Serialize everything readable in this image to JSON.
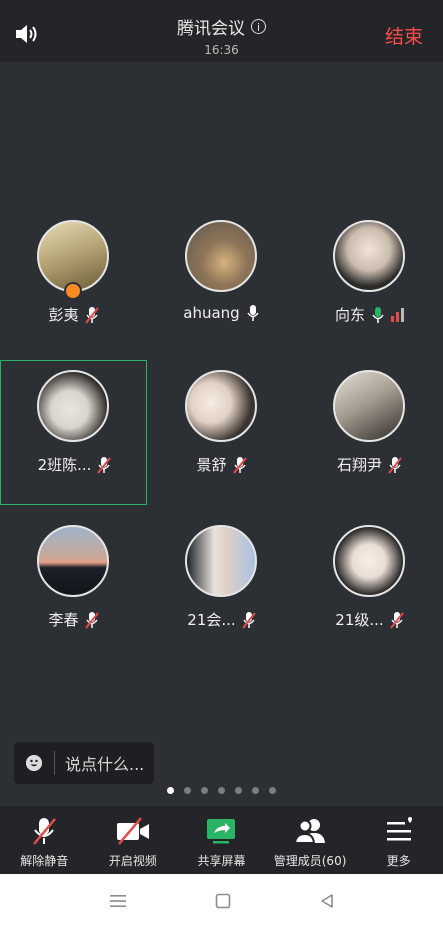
{
  "header": {
    "title": "腾讯会议",
    "time": "16:36",
    "end_label": "结束"
  },
  "participants": [
    {
      "name": "彭夷",
      "mic": "muted",
      "host": true,
      "avatar_colors": [
        "#d9cfa9",
        "#8a7a52"
      ]
    },
    {
      "name": "ahuang",
      "mic": "on",
      "host": false,
      "avatar_colors": [
        "#b9b2a8",
        "#6d6256"
      ]
    },
    {
      "name": "向东",
      "mic": "on",
      "signal": true,
      "avatar_colors": [
        "#e7e2dc",
        "#2a2a2a"
      ]
    },
    {
      "name": "2班陈...",
      "mic": "muted",
      "active": true,
      "avatar_colors": [
        "#e3e1dd",
        "#2a2524"
      ]
    },
    {
      "name": "景舒",
      "mic": "muted",
      "avatar_colors": [
        "#f1e9e1",
        "#3a3330"
      ]
    },
    {
      "name": "石翔尹",
      "mic": "muted",
      "avatar_colors": [
        "#d6d0c6",
        "#403a35"
      ]
    },
    {
      "name": "李春",
      "mic": "muted",
      "avatar_colors": [
        "#8fa5bf",
        "#1c2230"
      ]
    },
    {
      "name": "21会...",
      "mic": "muted",
      "avatar_colors": [
        "#c9d6e8",
        "#2b2e3a"
      ]
    },
    {
      "name": "21级...",
      "mic": "muted",
      "avatar_colors": [
        "#f4f0ec",
        "#2c2a2a"
      ]
    }
  ],
  "chat": {
    "placeholder": "说点什么..."
  },
  "pager": {
    "count": 7,
    "active_index": 0
  },
  "toolbar": {
    "unmute": "解除静音",
    "start_video": "开启视频",
    "share_screen": "共享屏幕",
    "manage_members": "管理成员(60)",
    "more": "更多"
  },
  "colors": {
    "end": "#ff4d4f",
    "share": "#29b365",
    "muted_slash": "#e64a4a",
    "active_border": "#29b365"
  }
}
